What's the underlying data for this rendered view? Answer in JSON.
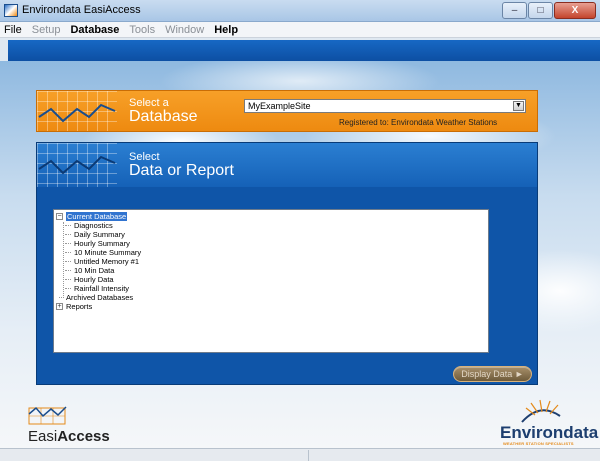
{
  "window": {
    "title": "Environdata EasiAccess",
    "buttons": {
      "minimize": "–",
      "maximize": "□",
      "close": "X"
    }
  },
  "menubar": [
    {
      "label": "File",
      "enabled": true,
      "bold": false
    },
    {
      "label": "Setup",
      "enabled": false,
      "bold": false
    },
    {
      "label": "Database",
      "enabled": true,
      "bold": true
    },
    {
      "label": "Tools",
      "enabled": false,
      "bold": false
    },
    {
      "label": "Window",
      "enabled": false,
      "bold": false
    },
    {
      "label": "Help",
      "enabled": true,
      "bold": true
    }
  ],
  "database_panel": {
    "subtitle": "Select a",
    "title": "Database",
    "selected_database": "MyExampleSite",
    "registered": "Registered to: Environdata Weather Stations"
  },
  "report_panel": {
    "subtitle": "Select",
    "title": "Data or Report",
    "tree": {
      "current_database": {
        "label": "Current Database",
        "expanded": true,
        "selected": true,
        "children": [
          "Diagnostics",
          "Daily Summary",
          "Hourly Summary",
          "10 Minute Summary",
          "Untitled Memory #1",
          "10 Min Data",
          "Hourly Data",
          "Rainfall Intensity"
        ]
      },
      "archived": {
        "label": "Archived Databases"
      },
      "reports": {
        "label": "Reports",
        "expanded": false
      }
    },
    "display_button": "Display Data ►"
  },
  "logos": {
    "easi_prefix": "Easi",
    "easi_suffix": "Access",
    "environdata": "Environdata",
    "environdata_tag": "WEATHER STATION SPECIALISTS"
  },
  "colors": {
    "orange": "#ee8a10",
    "blue_panel": "#0f55a8",
    "top_strip": "#1768c4"
  }
}
